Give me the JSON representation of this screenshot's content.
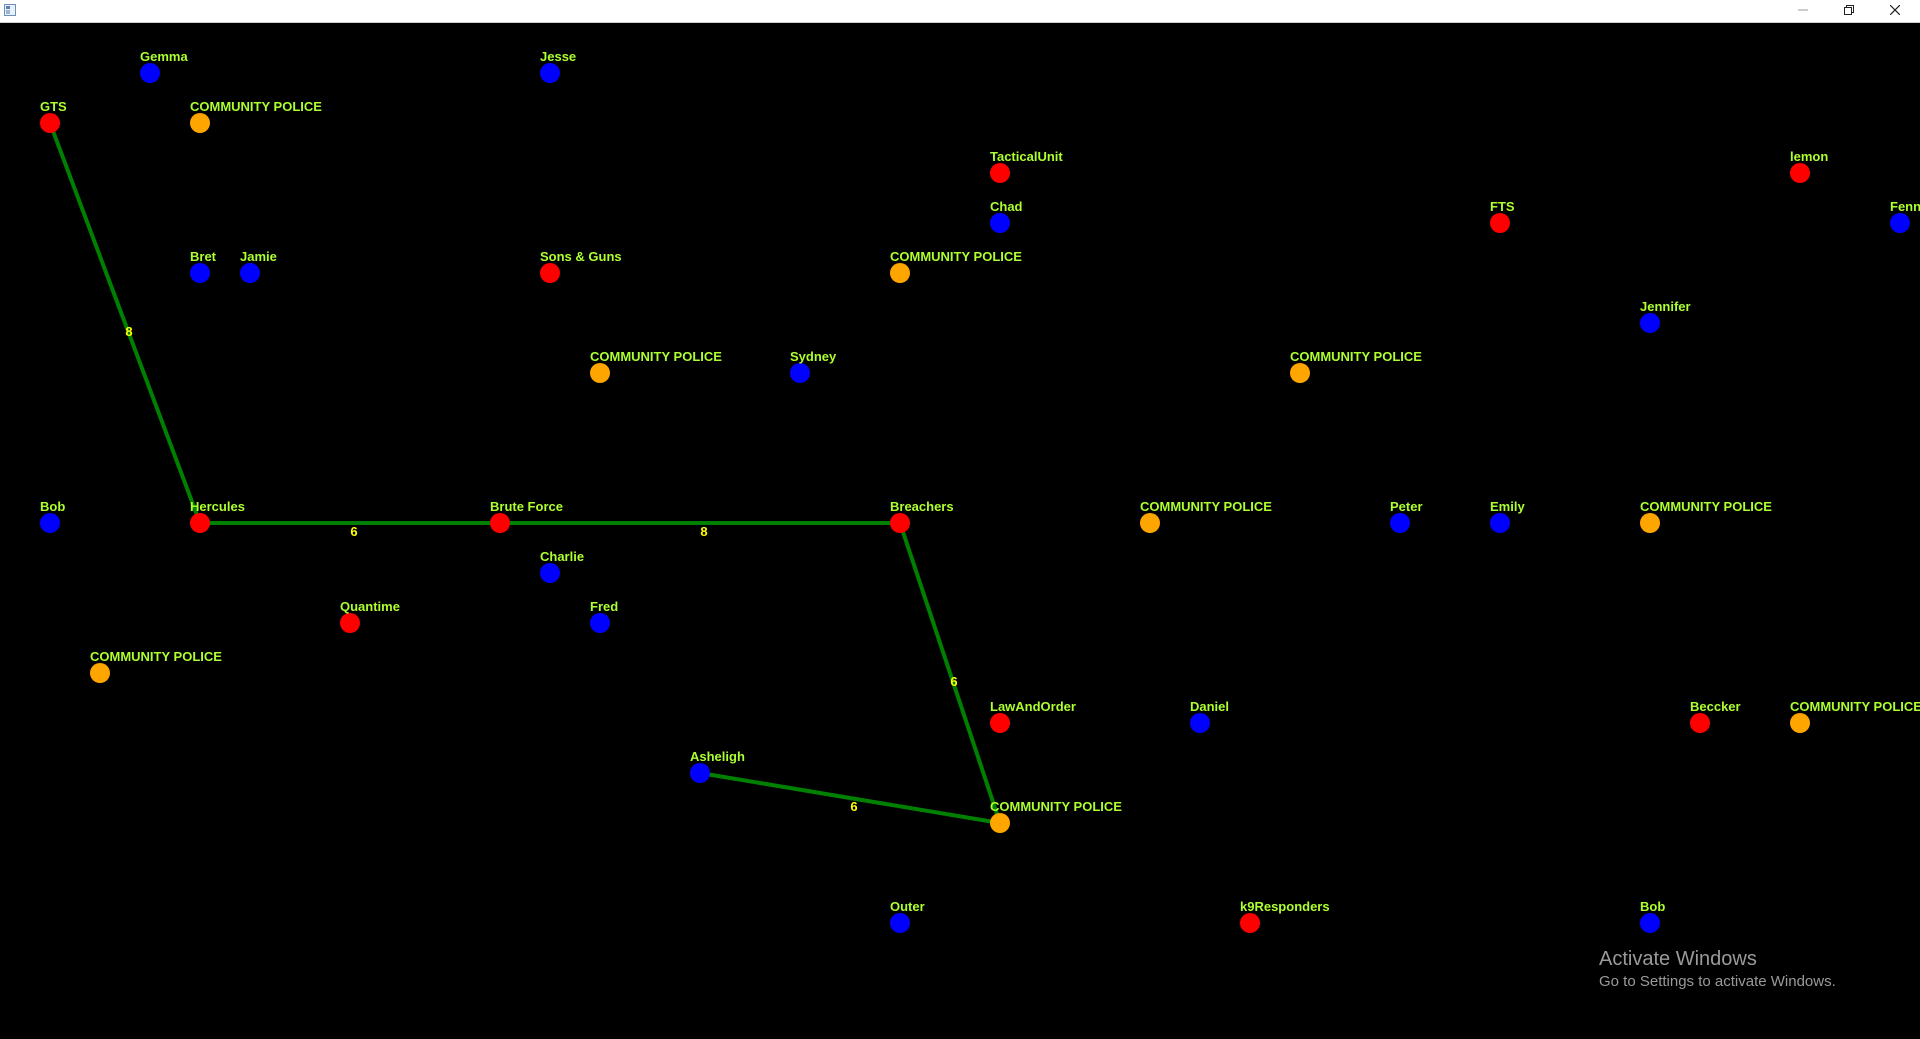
{
  "window": {
    "title": "",
    "controls": [
      "minimize",
      "maximize",
      "close"
    ]
  },
  "colors": {
    "background": "#000000",
    "user_node": "#0000ff",
    "team_node": "#ff0000",
    "police_node": "#ffa500",
    "edge": "#008000",
    "node_label": "#adff2f",
    "edge_label": "#ffff00"
  },
  "nodes": [
    {
      "id": "n1",
      "label": "Gemma",
      "type": "user"
    },
    {
      "id": "n2",
      "label": "Jesse",
      "type": "user"
    },
    {
      "id": "n3",
      "label": "GTS",
      "type": "team"
    },
    {
      "id": "n4",
      "label": "COMMUNITY POLICE",
      "type": "police"
    },
    {
      "id": "n5",
      "label": "TacticalUnit",
      "type": "team"
    },
    {
      "id": "n6",
      "label": "lemon",
      "type": "team"
    },
    {
      "id": "n7",
      "label": "Chad",
      "type": "user"
    },
    {
      "id": "n8",
      "label": "FTS",
      "type": "team"
    },
    {
      "id": "n9",
      "label": "Fenn",
      "type": "user"
    },
    {
      "id": "n10",
      "label": "Bret",
      "type": "user"
    },
    {
      "id": "n11",
      "label": "Jamie",
      "type": "user"
    },
    {
      "id": "n12",
      "label": "Sons & Guns",
      "type": "team"
    },
    {
      "id": "n13",
      "label": "COMMUNITY POLICE",
      "type": "police"
    },
    {
      "id": "n14",
      "label": "Jennifer",
      "type": "user"
    },
    {
      "id": "n15",
      "label": "COMMUNITY POLICE",
      "type": "police"
    },
    {
      "id": "n16",
      "label": "Sydney",
      "type": "user"
    },
    {
      "id": "n17",
      "label": "COMMUNITY POLICE",
      "type": "police"
    },
    {
      "id": "n18",
      "label": "Bob",
      "type": "user"
    },
    {
      "id": "n19",
      "label": "Hercules",
      "type": "team"
    },
    {
      "id": "n20",
      "label": "Brute Force",
      "type": "team"
    },
    {
      "id": "n21",
      "label": "Breachers",
      "type": "team"
    },
    {
      "id": "n22",
      "label": "COMMUNITY POLICE",
      "type": "police"
    },
    {
      "id": "n23",
      "label": "Peter",
      "type": "user"
    },
    {
      "id": "n24",
      "label": "Emily",
      "type": "user"
    },
    {
      "id": "n25",
      "label": "COMMUNITY POLICE",
      "type": "police"
    },
    {
      "id": "n26",
      "label": "Charlie",
      "type": "user"
    },
    {
      "id": "n27",
      "label": "Quantime",
      "type": "team"
    },
    {
      "id": "n28",
      "label": "Fred",
      "type": "user"
    },
    {
      "id": "n29",
      "label": "COMMUNITY POLICE",
      "type": "police"
    },
    {
      "id": "n30",
      "label": "LawAndOrder",
      "type": "team"
    },
    {
      "id": "n31",
      "label": "Daniel",
      "type": "user"
    },
    {
      "id": "n32",
      "label": "Beccker",
      "type": "team"
    },
    {
      "id": "n33",
      "label": "COMMUNITY POLICE",
      "type": "police"
    },
    {
      "id": "n34",
      "label": "Asheligh",
      "type": "user"
    },
    {
      "id": "n35",
      "label": "COMMUNITY POLICE",
      "type": "police"
    },
    {
      "id": "n36",
      "label": "Outer",
      "type": "user"
    },
    {
      "id": "n37",
      "label": "k9Responders",
      "type": "team"
    },
    {
      "id": "n38",
      "label": "Bob",
      "type": "user"
    }
  ],
  "edges": [
    {
      "from": "n3",
      "to": "n19",
      "weight": "8"
    },
    {
      "from": "n19",
      "to": "n20",
      "weight": "6"
    },
    {
      "from": "n20",
      "to": "n21",
      "weight": "8"
    },
    {
      "from": "n21",
      "to": "n35",
      "weight": "6"
    },
    {
      "from": "n34",
      "to": "n35",
      "weight": "6"
    }
  ],
  "watermark": {
    "title": "Activate Windows",
    "subtitle": "Go to Settings to activate Windows."
  }
}
